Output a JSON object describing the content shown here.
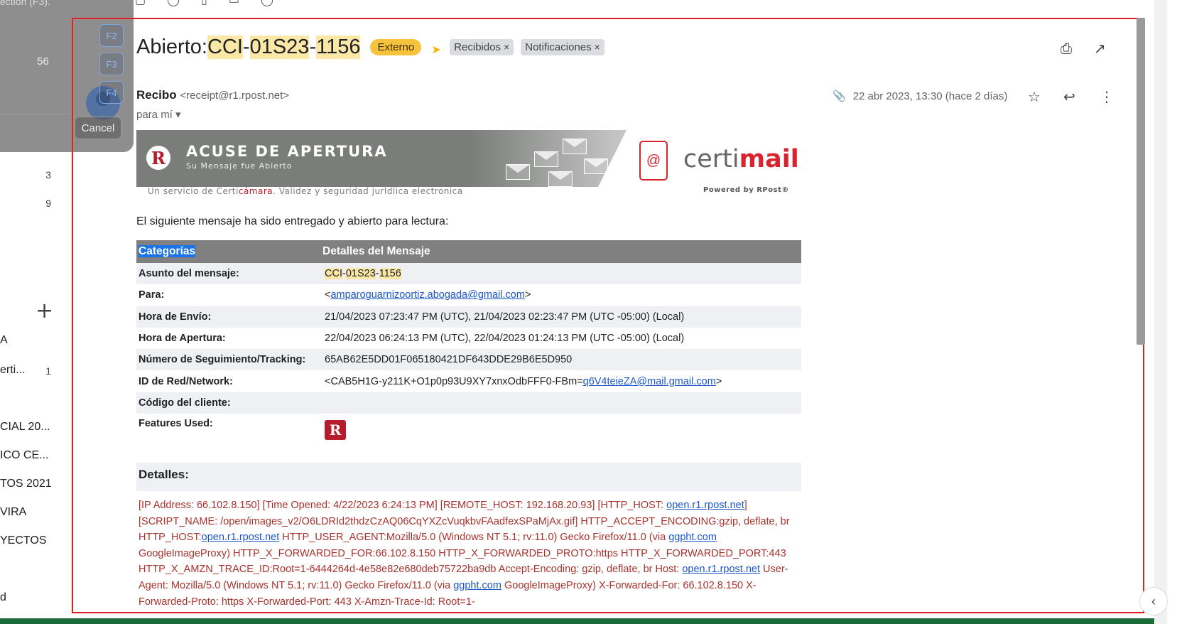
{
  "sidebar": {
    "overlay_count": "56",
    "counts": [
      {
        "label": "",
        "count": "3"
      },
      {
        "label": "",
        "count": "9"
      }
    ],
    "labels": [
      {
        "label": "A",
        "count": ""
      },
      {
        "label": "erti...",
        "count": "1"
      },
      {
        "label": "CIAL 20...",
        "count": ""
      },
      {
        "label": "ICO CE...",
        "count": ""
      },
      {
        "label": "TOS 2021",
        "count": ""
      },
      {
        "label": "VIRA",
        "count": ""
      },
      {
        "label": "YECTOS",
        "count": ""
      },
      {
        "label": "d",
        "count": ""
      }
    ]
  },
  "overlay": {
    "top_text": "ection (F3).",
    "fkeys": [
      "F2",
      "F3",
      "F4"
    ],
    "cancel_label": "Cancel"
  },
  "email": {
    "subject_prefix": "Abierto: ",
    "subject_parts": [
      "CCI",
      "-",
      "01S23",
      "-",
      "1156"
    ],
    "chip_externo": "Externo",
    "labels": [
      "Recibidos",
      "Notificaciones"
    ],
    "sender_name": "Recibo",
    "sender_addr": "<receipt@r1.rpost.net>",
    "to_me": "para mí",
    "date": "22 abr 2023, 13:30 (hace 2 días)",
    "icons": [
      "print-icon",
      "open-in-new-icon",
      "attachment-icon",
      "star-icon",
      "reply-icon",
      "more-vert-icon"
    ]
  },
  "banner": {
    "title": "ACUSE DE APERTURA",
    "subtitle": "Su Mensaje fue Abierto",
    "under_a": "Un servicio de Certi",
    "under_red": "cámara",
    "under_b": ". Validez y seguridad jurldlica electronica",
    "certi_gray": "certi",
    "certi_red": "mail",
    "powered": "Powered by RPost®"
  },
  "intro": "El siguiente mensaje ha sido entregado y abierto para lectura:",
  "table": {
    "header": [
      "Categorías",
      "Detalles del Mensaje"
    ],
    "rows": [
      {
        "k": "Asunto del mensaje:",
        "v": "CCI-01S23-1156"
      },
      {
        "k": "Para:",
        "v_pre": "<",
        "v_link": "amparoguarnizoortiz.abogada@gmail.com",
        "v_post": ">"
      },
      {
        "k": "Hora de Envío:",
        "v": "21/04/2023 07:23:47 PM (UTC), 21/04/2023 02:23:47 PM (UTC -05:00) (Local)"
      },
      {
        "k": "Hora de Apertura:",
        "v": "22/04/2023 06:24:13 PM (UTC), 22/04/2023 01:24:13 PM (UTC -05:00) (Local)"
      },
      {
        "k": "Número de Seguimiento/Tracking:",
        "v": "65AB62E5DD01F065180421DF643DDE29B6E5D950"
      },
      {
        "k": "ID de Red/Network:",
        "v_pre": "<CAB5H1G-y211K+O1p0p93U9XY7xnxOdbFFF0-FBm=",
        "v_link": "q6V4teieZA@mail.gmail.com",
        "v_post": ">"
      },
      {
        "k": "Código del cliente:",
        "v": ""
      },
      {
        "k": "Features Used:",
        "v": "R"
      }
    ]
  },
  "detalles": {
    "title": "Detalles:",
    "p1": "[IP Address: 66.102.8.150] [Time Opened: 4/22/2023 6:24:13 PM] [REMOTE_HOST: 192.168.20.93] [HTTP_HOST: ",
    "l1": "open.r1.rpost.net",
    "p2": "] [SCRIPT_NAME: /open/images_v2/O6LDRId2thdzCzAQ06CqYXZcVuqkbvFAadfexSPaMjAx.gif] HTTP_ACCEPT_ENCODING:gzip, deflate, br HTTP_HOST:",
    "l2": "open.r1.rpost.net",
    "p3": " HTTP_USER_AGENT:Mozilla/5.0 (Windows NT 5.1; rv:11.0) Gecko Firefox/11.0 (via ",
    "l3": "ggpht.com",
    "p4": " GoogleImageProxy) HTTP_X_FORWARDED_FOR:66.102.8.150 HTTP_X_FORWARDED_PROTO:https HTTP_X_FORWARDED_PORT:443 HTTP_X_AMZN_TRACE_ID:Root=1-6444264d-4e58e82e680deb75722ba9db Accept-Encoding: gzip, deflate, br Host: ",
    "l4": "open.r1.rpost.net",
    "p5": " User-Agent: Mozilla/5.0 (Windows NT 5.1; rv:11.0) Gecko Firefox/11.0 (via ",
    "l5": "ggpht.com",
    "p6": " GoogleImageProxy) X-Forwarded-For: 66.102.8.150 X-Forwarded-Proto: https X-Forwarded-Port: 443 X-Amzn-Trace-Id: Root=1-"
  },
  "colors": {
    "frame": "#e0211f",
    "chip_externo": "#f7c23c",
    "highlight": "#fce8a6",
    "details_text": "#a8322c",
    "link": "#1a56c8",
    "bottom_bar": "#1e6b3a"
  }
}
